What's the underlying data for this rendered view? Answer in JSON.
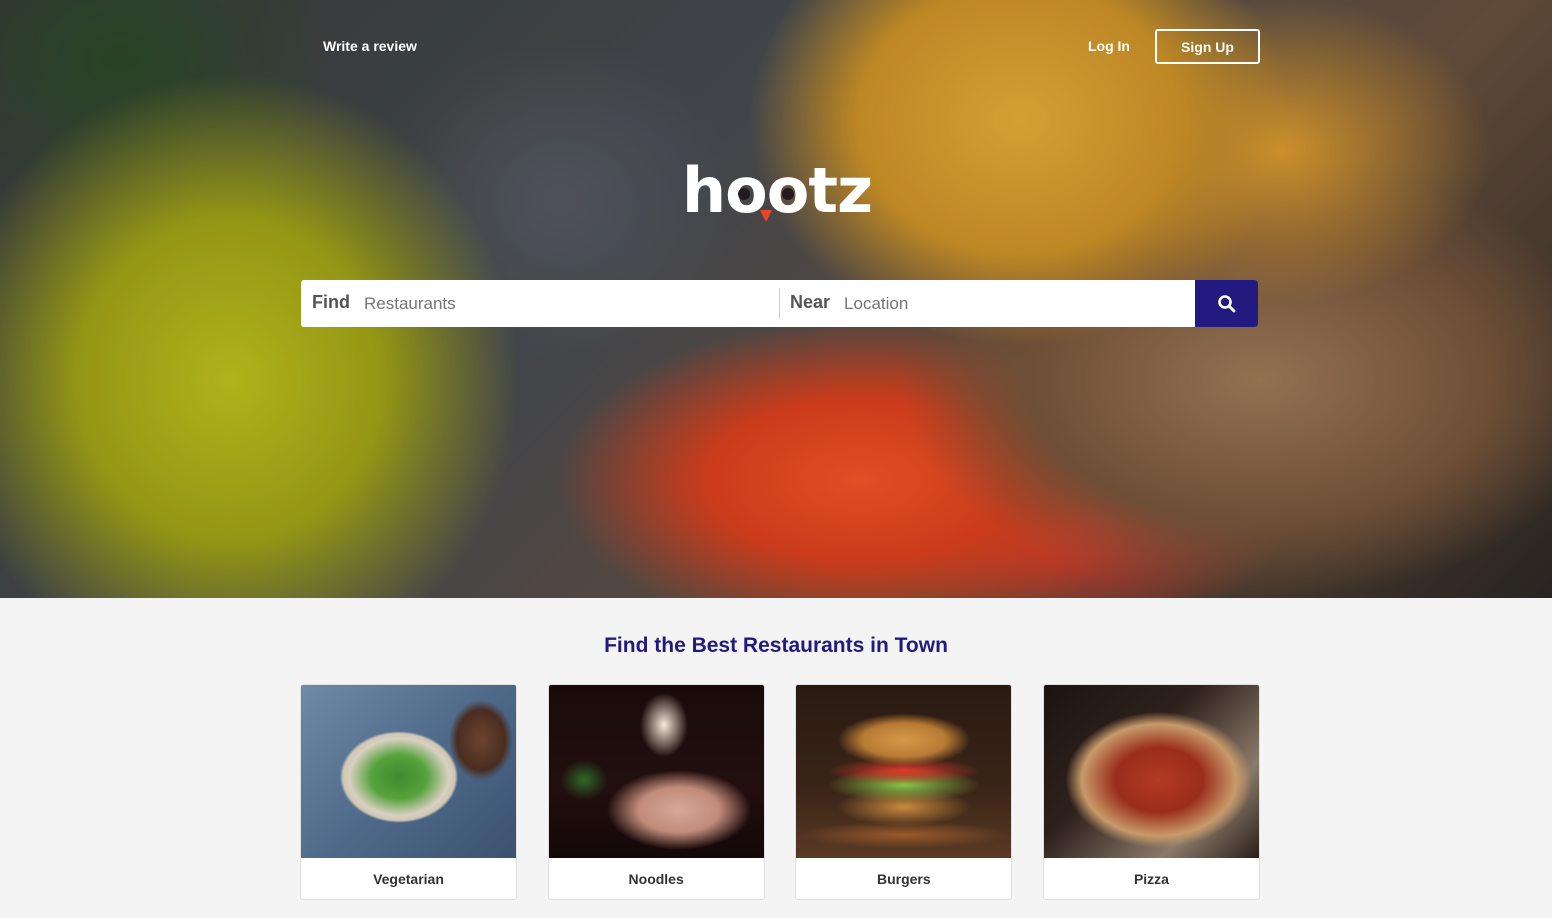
{
  "nav": {
    "write_review": "Write a review",
    "login": "Log In",
    "signup": "Sign Up"
  },
  "logo": {
    "text": "hootz",
    "accent_color": "#e8442a"
  },
  "search": {
    "find_label": "Find",
    "find_placeholder": "Restaurants",
    "near_label": "Near",
    "near_placeholder": "Location",
    "button_icon": "search-icon",
    "button_color": "#231a7f"
  },
  "main": {
    "title": "Find the Best Restaurants in Town",
    "categories": [
      {
        "label": "Vegetarian"
      },
      {
        "label": "Noodles"
      },
      {
        "label": "Burgers"
      },
      {
        "label": "Pizza"
      }
    ]
  },
  "colors": {
    "brand": "#231a7f",
    "background": "#f4f4f4"
  }
}
